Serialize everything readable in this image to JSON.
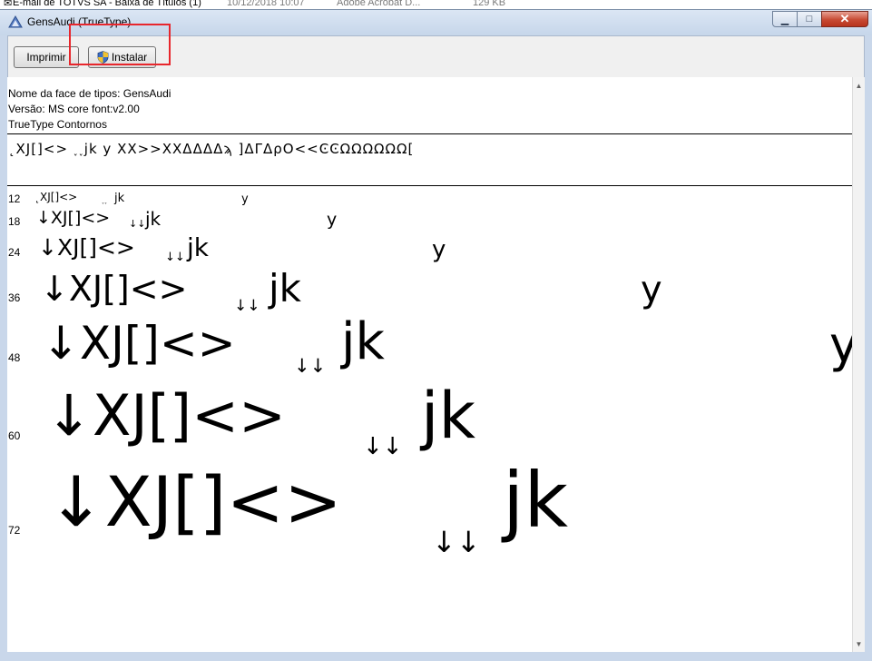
{
  "background_strip": {
    "item1": "E-mail de TOTVS SA - Baixa de Títulos (1)",
    "date1": "10/12/2018 10:07",
    "app1": "Adobe Acrobat D...",
    "size1": "129 KB"
  },
  "window": {
    "title": "GensAudi (TrueType)",
    "controls": {
      "minimize": "▁",
      "maximize": "□",
      "close": "✕"
    }
  },
  "toolbar": {
    "print_label": "Imprimir",
    "install_label": "Instalar"
  },
  "font_info": {
    "face_name": "Nome da face de tipos: GensAudi",
    "version": "Versão: MS core font:v2.00",
    "outline_type": "TrueType Contornos"
  },
  "character_set": "˛XJ[]<> ˯˯jk                y    XX>>XXΔΔΔΔϡ ]ΔΓΔρΟ<<ϾϾΩΩΩΩΩΩ[",
  "samples": [
    {
      "size": "12",
      "seg1": "˛XJ[]<>",
      "seg2": "˯˯",
      "seg3": "jk",
      "seg4": "y"
    },
    {
      "size": "18",
      "seg1": "↓XJ[]<>",
      "seg2": "↓↓",
      "seg3": "jk",
      "seg4": "y"
    },
    {
      "size": "24",
      "seg1": "↓XJ[]<>",
      "seg2": "↓↓",
      "seg3": "jk",
      "seg4": "y"
    },
    {
      "size": "36",
      "seg1": "↓XJ[]<>",
      "seg2": "↓↓",
      "seg3": "jk",
      "seg4": "y"
    },
    {
      "size": "48",
      "seg1": "↓XJ[]<>",
      "seg2": "↓↓",
      "seg3": "jk",
      "seg4": "y"
    },
    {
      "size": "60",
      "seg1": "↓XJ[]<>",
      "seg2": "↓↓",
      "seg3": "jk",
      "seg4": ""
    },
    {
      "size": "72",
      "seg1": "↓XJ[]<>",
      "seg2": "↓↓",
      "seg3": "jk",
      "seg4": ""
    }
  ],
  "colors": {
    "highlight_box": "#e8262c",
    "close_button": "#c74a33"
  }
}
